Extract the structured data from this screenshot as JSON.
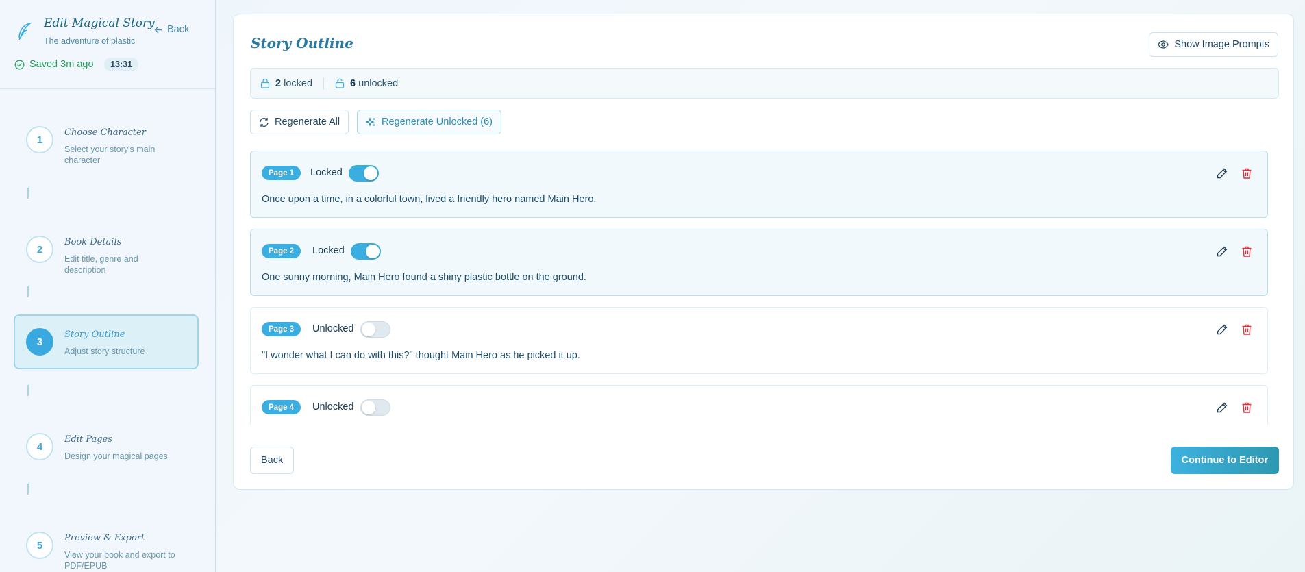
{
  "sidebar": {
    "title": "Edit Magical Story",
    "subtitle": "The adventure of plastic",
    "back_label": "Back",
    "saved_label": "Saved 3m ago",
    "timer": "13:31",
    "steps": [
      {
        "num": "1",
        "title": "Choose Character",
        "desc": "Select your story's main character"
      },
      {
        "num": "2",
        "title": "Book Details",
        "desc": "Edit title, genre and description"
      },
      {
        "num": "3",
        "title": "Story Outline",
        "desc": "Adjust story structure"
      },
      {
        "num": "4",
        "title": "Edit Pages",
        "desc": "Design your magical pages"
      },
      {
        "num": "5",
        "title": "Preview & Export",
        "desc": "View your book and export to PDF/EPUB"
      }
    ]
  },
  "main": {
    "title": "Story Outline",
    "show_prompts_label": "Show Image Prompts",
    "locked_count": "2",
    "locked_label": "locked",
    "unlocked_count": "6",
    "unlocked_label": "unlocked",
    "regen_all_label": "Regenerate All",
    "regen_unlocked_label": "Regenerate Unlocked (6)",
    "pages": [
      {
        "badge": "Page 1",
        "status": "Locked",
        "locked": true,
        "text": "Once upon a time, in a colorful town, lived a friendly hero named Main Hero."
      },
      {
        "badge": "Page 2",
        "status": "Locked",
        "locked": true,
        "text": "One sunny morning, Main Hero found a shiny plastic bottle on the ground."
      },
      {
        "badge": "Page 3",
        "status": "Unlocked",
        "locked": false,
        "text": "\"I wonder what I can do with this?\" thought Main Hero as he picked it up."
      },
      {
        "badge": "Page 4",
        "status": "Unlocked",
        "locked": false,
        "text": ""
      }
    ],
    "back_label": "Back",
    "continue_label": "Continue to Editor"
  },
  "colors": {
    "accent": "#3aaee1",
    "delete": "#e0303c",
    "saved": "#25a25a"
  }
}
